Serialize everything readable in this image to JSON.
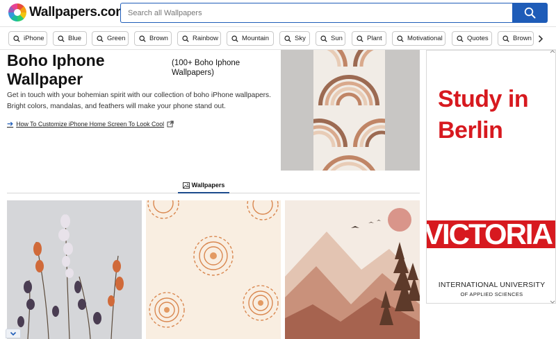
{
  "header": {
    "logo_text": "Wallpapers.com",
    "search_placeholder": "Search all Wallpapers"
  },
  "tags": [
    "iPhone",
    "Blue",
    "Green",
    "Brown",
    "Rainbow",
    "Mountain",
    "Sky",
    "Sun",
    "Plant",
    "Motivational",
    "Quotes",
    "Brown"
  ],
  "main": {
    "title": "Boho Iphone Wallpaper",
    "count_label": "(100+ Boho Iphone Wallpapers)",
    "description": "Get in touch with your bohemian spirit with our collection of boho iPhone wallpapers. Bright colors, mandalas, and feathers will make your phone stand out.",
    "howto_link": "How To Customize iPhone Home Screen To Look Cool",
    "tab_label": "Wallpapers"
  },
  "ad": {
    "headline": "Study in Berlin",
    "brand": "VICTORIA",
    "university": "INTERNATIONAL UNIVERSITY",
    "subtitle": "OF APPLIED SCIENCES"
  },
  "colors": {
    "accent": "#1e5cb8",
    "ad_red": "#d7191f",
    "tab_underline": "#1a4a8c"
  },
  "icons": {
    "search": "search-icon",
    "chip": "search-icon",
    "next": "chevron-right-icon",
    "link_arrow": "arrow-right-icon",
    "external": "external-link-icon",
    "tab": "image-icon",
    "scroll": "chevron-down-icon"
  }
}
